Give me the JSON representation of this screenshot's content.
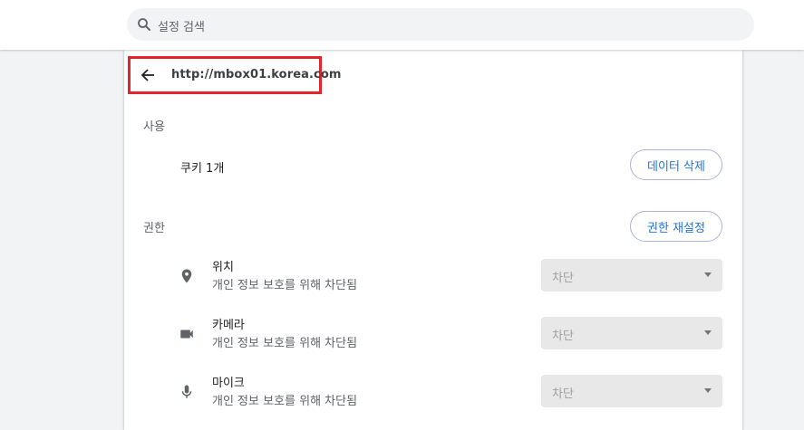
{
  "search": {
    "placeholder": "설정 검색",
    "icon": "search-icon"
  },
  "site": {
    "url": "http://mbox01.korea.com",
    "back_icon": "arrow-back-icon"
  },
  "usage": {
    "section_label": "사용",
    "cookies_text": "쿠키 1개",
    "clear_data_button": "데이터 삭제"
  },
  "permissions": {
    "section_label": "권한",
    "reset_button": "권한 재설정",
    "items": [
      {
        "title": "위치",
        "subtitle": "개인 정보 보호를 위해 차단됨",
        "value": "차단",
        "icon": "location-pin-icon"
      },
      {
        "title": "카메라",
        "subtitle": "개인 정보 보호를 위해 차단됨",
        "value": "차단",
        "icon": "camera-icon"
      },
      {
        "title": "마이크",
        "subtitle": "개인 정보 보호를 위해 차단됨",
        "value": "차단",
        "icon": "microphone-icon"
      }
    ]
  },
  "colors": {
    "accent": "#1a73e8",
    "highlight_border": "#e3242b",
    "disabled_select_bg": "#e8e8e8"
  }
}
